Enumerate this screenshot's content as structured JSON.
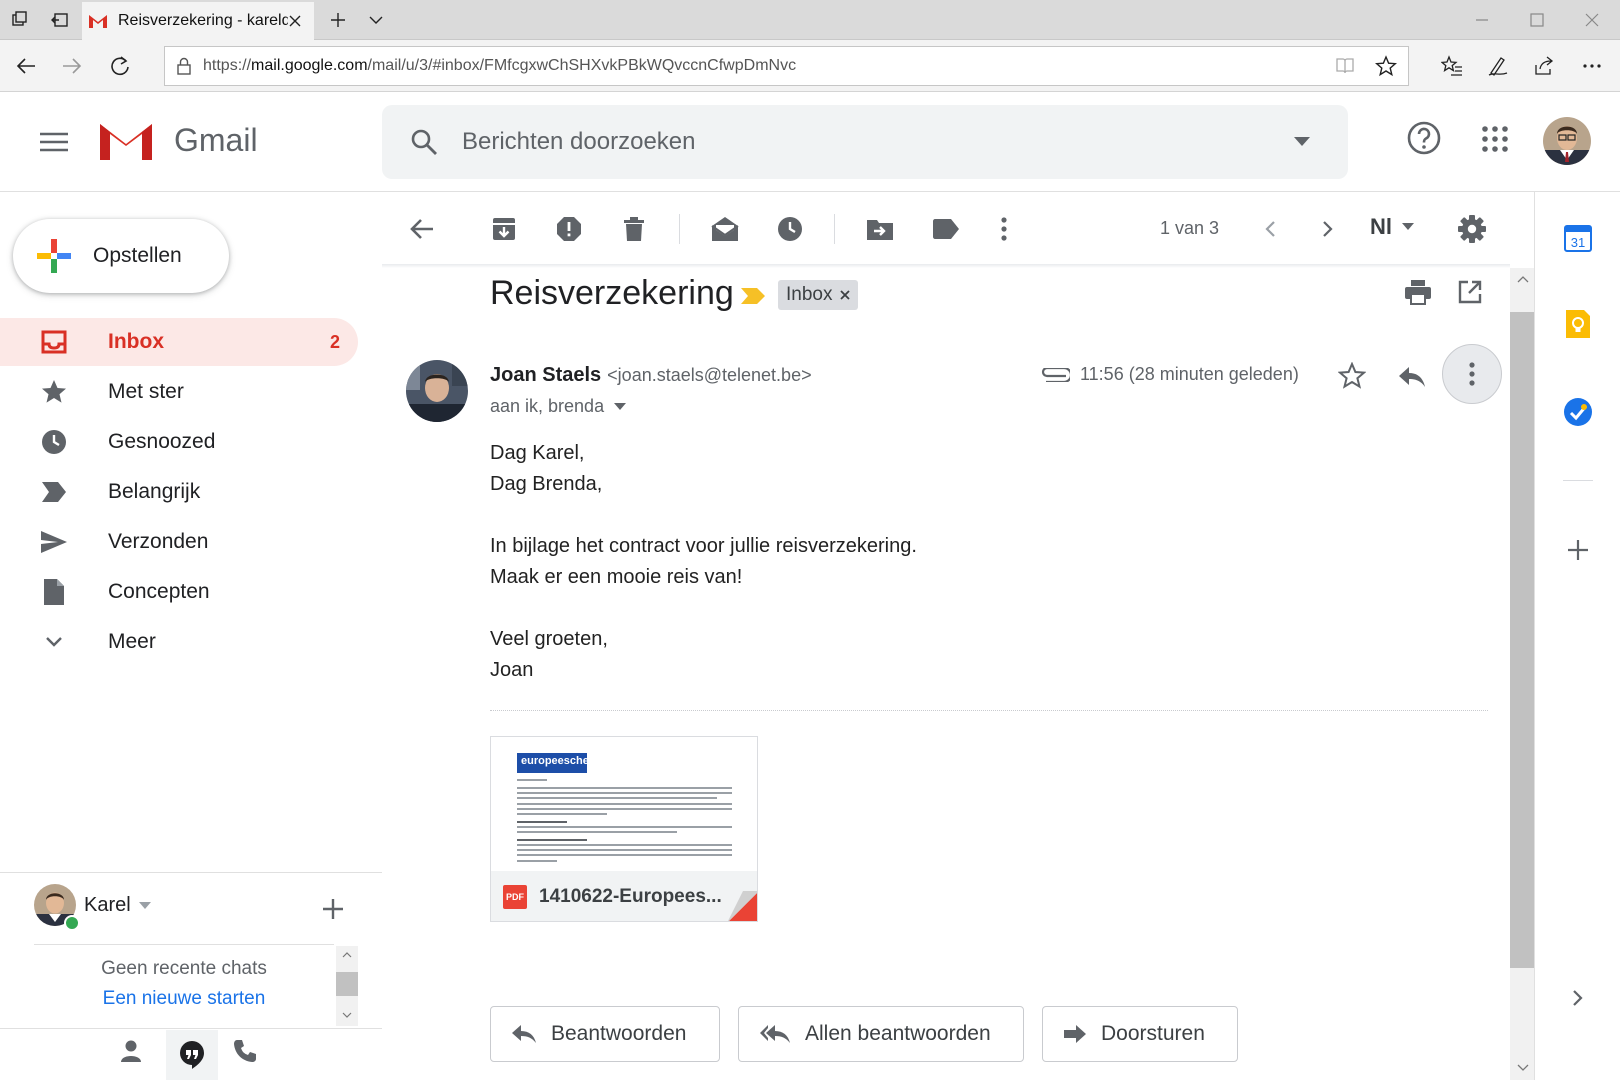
{
  "browser": {
    "tab_title": "Reisverzekering - kareld",
    "url_prefix": "https://",
    "url_host": "mail.google.com",
    "url_path": "/mail/u/3/#inbox/FMfcgxwChSHXvkPBkWQvccnCfwpDmNvc"
  },
  "header": {
    "app_name": "Gmail",
    "search_placeholder": "Berichten doorzoeken"
  },
  "sidebar": {
    "compose_label": "Opstellen",
    "items": [
      {
        "label": "Inbox",
        "count": "2"
      },
      {
        "label": "Met ster"
      },
      {
        "label": "Gesnoozed"
      },
      {
        "label": "Belangrijk"
      },
      {
        "label": "Verzonden"
      },
      {
        "label": "Concepten"
      },
      {
        "label": "Meer"
      }
    ]
  },
  "chat": {
    "user_name": "Karel",
    "no_recent": "Geen recente chats",
    "start_new": "Een nieuwe starten"
  },
  "toolbar": {
    "pagination": "1 van 3",
    "language": "Nl"
  },
  "message": {
    "subject": "Reisverzekering",
    "label_chip": "Inbox",
    "sender_name": "Joan Staels",
    "sender_email": "<joan.staels@telenet.be>",
    "recipients": "aan ik, brenda",
    "time": "11:56 (28 minuten geleden)",
    "body": {
      "line1": "Dag Karel,",
      "line2": "Dag Brenda,",
      "line3": "In bijlage het contract voor jullie reisverzekering.",
      "line4": "Maak er een mooie reis van!",
      "line5": "Veel groeten,",
      "line6": "Joan"
    },
    "attachment": {
      "file_name": "1410622-Europees...",
      "type_badge": "PDF",
      "logo_text": "europeesche"
    }
  },
  "actions": {
    "reply": "Beantwoorden",
    "reply_all": "Allen beantwoorden",
    "forward": "Doorsturen"
  },
  "right_rail": {
    "calendar_day": "31"
  },
  "colors": {
    "gmail_red": "#d93025",
    "inbox_bg": "#fce8e6",
    "link_blue": "#1a73e8",
    "online_green": "#34a853"
  }
}
